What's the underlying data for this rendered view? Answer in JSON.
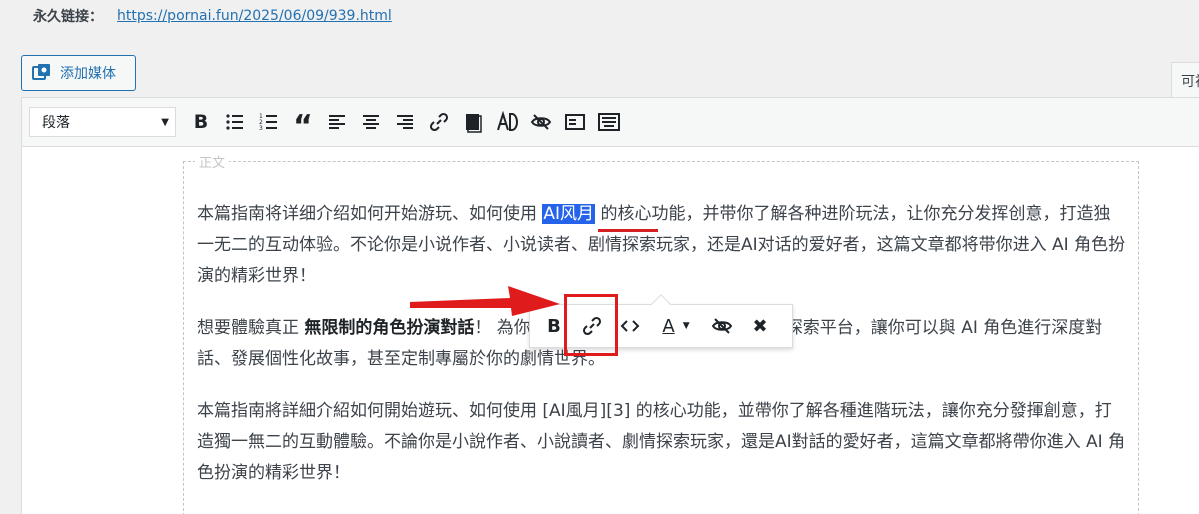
{
  "permalink": {
    "label": "永久链接：",
    "url": "https://pornai.fun/2025/06/09/939.html"
  },
  "add_media": {
    "label": "添加媒体",
    "icon": "media-icon"
  },
  "tabs": {
    "visual": "可视化"
  },
  "toolbar": {
    "format_select": "段落",
    "buttons": [
      "bold",
      "bulleted-list",
      "numbered-list",
      "blockquote",
      "align-left",
      "align-center",
      "align-right",
      "insert-link",
      "read-more",
      "ai-toggle",
      "hide-toggle",
      "blank-template",
      "keyboard"
    ]
  },
  "content": {
    "label": "正文",
    "p1_before": "本篇指南将详细介绍如何开始游玩、如何使用 ",
    "p1_highlight": "AI风月",
    "p1_after": " 的核心功能，并带你了解各种进阶玩法，让你充分发挥创意，打造独一无二的互动体验。不论你是小说作者、小说读者、剧情探索玩家，还是AI对话的爱好者，这篇文章都将带你进入 AI 角色扮演的精彩世界！",
    "p2_before": "想要體驗真正 ",
    "p2_bold": "無限制的角色扮演對話",
    "p2_after": "！",
    "p2_hidden_tail": " 為你打造了一個前所未有的自由創作與探索平台，讓你可以與 AI 角色進行深度對話、發展個性化故事，甚至定制專屬於你的劇情世界。",
    "p3": "本篇指南將詳細介紹如何開始遊玩、如何使用 [AI風月][3] 的核心功能，並帶你了解各種進階玩法，讓你充分發揮創意，打造獨一無二的互動體驗。不論你是小說作者、小說讀者、劇情探索玩家，還是AI對話的愛好者，這篇文章都將帶你進入 AI 角色扮演的精彩世界！"
  },
  "inline_toolbar": {
    "bold_label": "B",
    "text_color_label": "A",
    "close_label": "✖"
  },
  "colors": {
    "highlight": "#2563eb",
    "annotation_red": "#e01b1b",
    "link_blue": "#2271b1"
  }
}
